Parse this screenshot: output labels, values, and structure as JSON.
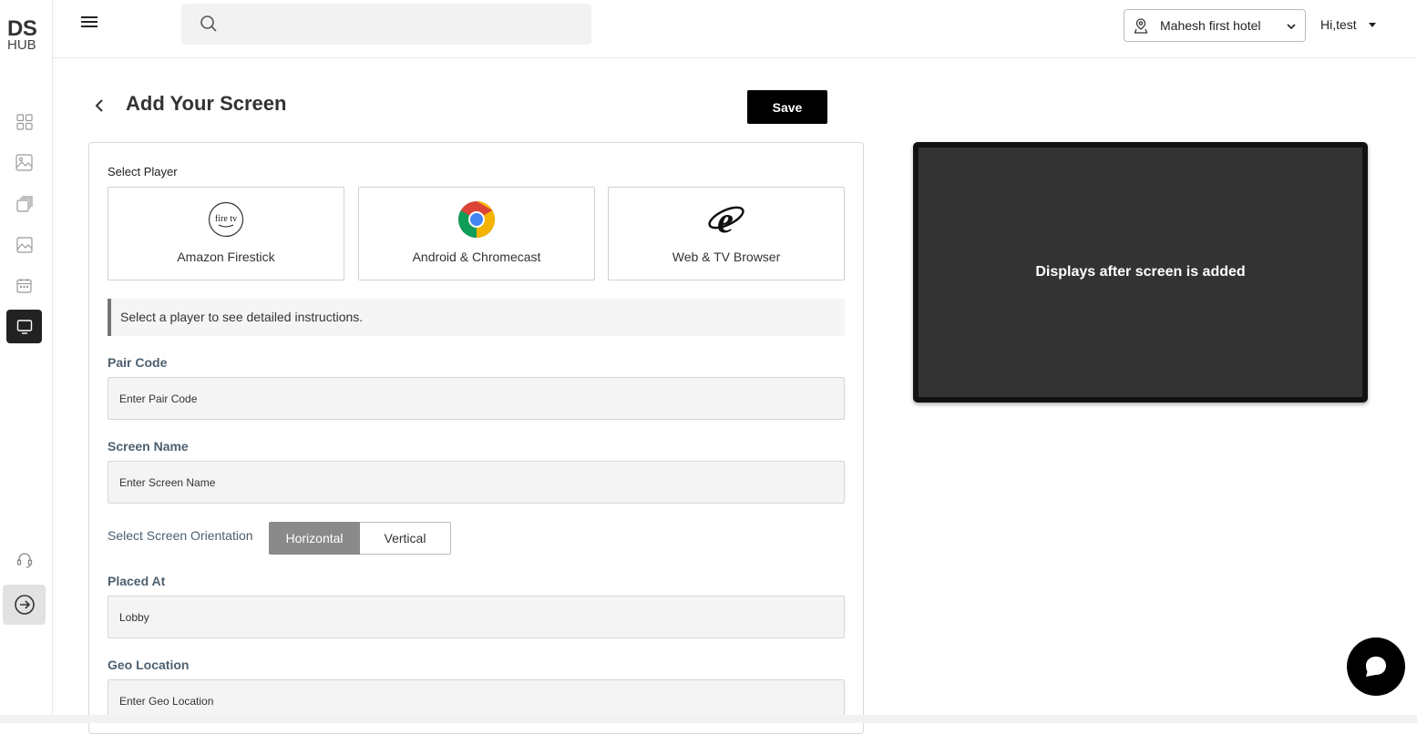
{
  "brand": {
    "logo_top": "DS",
    "logo_bottom": "HUB"
  },
  "header": {
    "search_placeholder": "",
    "hotel_select": "Mahesh first hotel",
    "user_greeting": "Hi,test"
  },
  "sidebar": {
    "items": [
      {
        "icon": "dashboard-grid-icon"
      },
      {
        "icon": "media-gallery-icon"
      },
      {
        "icon": "playlists-icon"
      },
      {
        "icon": "image-icon"
      },
      {
        "icon": "calendar-icon"
      },
      {
        "icon": "screen-monitor-icon",
        "active": true
      }
    ],
    "bottom": [
      {
        "icon": "support-headset-icon"
      },
      {
        "icon": "logout-arrow-icon"
      }
    ]
  },
  "page": {
    "title": "Add Your Screen",
    "save_label": "Save"
  },
  "form": {
    "select_player_label": "Select Player",
    "players": [
      {
        "name": "Amazon Firestick",
        "logo_text": "fire tv",
        "icon": "fire-tv-logo-icon"
      },
      {
        "name": "Android & Chromecast",
        "icon": "chrome-logo-icon"
      },
      {
        "name": "Web & TV Browser",
        "icon": "internet-explorer-logo-icon"
      }
    ],
    "hint": "Select a player to see detailed instructions.",
    "pair_code": {
      "label": "Pair Code",
      "placeholder": "Enter Pair Code"
    },
    "screen_name": {
      "label": "Screen Name",
      "placeholder": "Enter Screen Name"
    },
    "orientation": {
      "label": "Select Screen Orientation",
      "options": [
        "Horizontal",
        "Vertical"
      ],
      "selected": "Horizontal"
    },
    "placed_at": {
      "label": "Placed At",
      "value": "Lobby"
    },
    "geo_location": {
      "label": "Geo Location",
      "placeholder": "Enter Geo Location"
    }
  },
  "preview": {
    "message": "Displays after screen is added"
  },
  "colors": {
    "primary": "#000000",
    "label": "#4d6070",
    "preview_bg": "#333333"
  }
}
